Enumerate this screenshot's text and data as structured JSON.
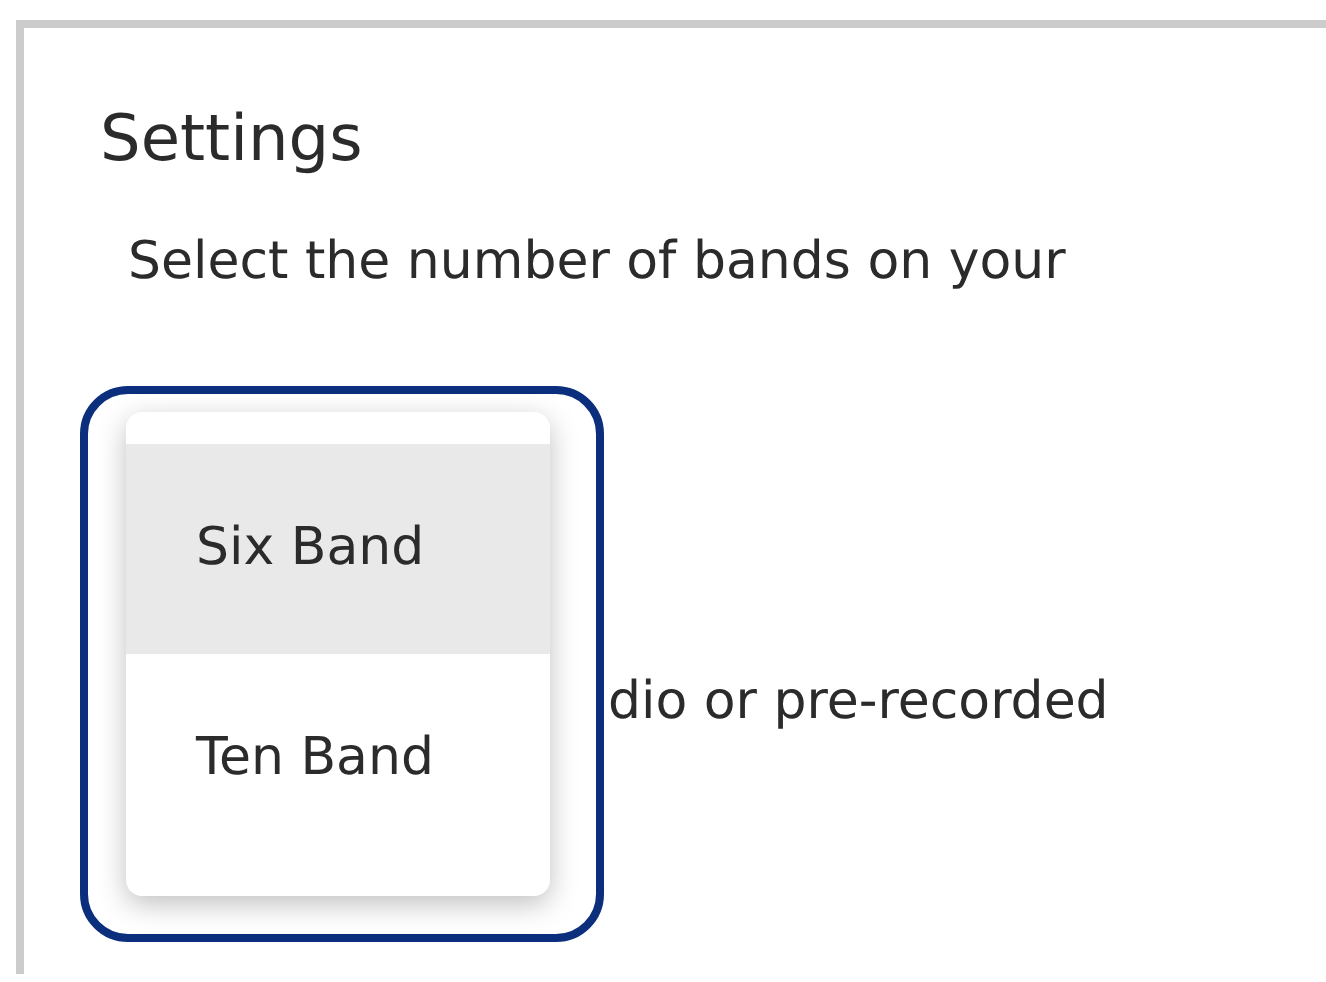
{
  "heading": "Settings",
  "texts": [
    {
      "text": "Select the number of bands on your"
    },
    {
      "text": "dio or pre-recorded"
    }
  ],
  "dropdown": {
    "focused": true,
    "options": [
      {
        "label": "Six Band",
        "selected": true
      },
      {
        "label": "Ten Band",
        "selected": false
      }
    ]
  }
}
